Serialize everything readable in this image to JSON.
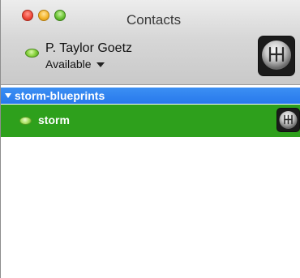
{
  "window": {
    "title": "Contacts",
    "controls": [
      "close",
      "minimize",
      "zoom"
    ]
  },
  "user": {
    "name": "P. Taylor Goetz",
    "status": "Available",
    "status_icon": "status-available-icon",
    "avatar_icon": "gear-shifter-avatar"
  },
  "groups": [
    {
      "label": "storm-blueprints",
      "expanded": true,
      "contacts": [
        {
          "name": "storm",
          "status_icon": "status-available-icon",
          "avatar_icon": "gear-shifter-avatar"
        }
      ]
    }
  ],
  "colors": {
    "group_header": "#2879ec",
    "selected_row": "#2ea01c"
  }
}
